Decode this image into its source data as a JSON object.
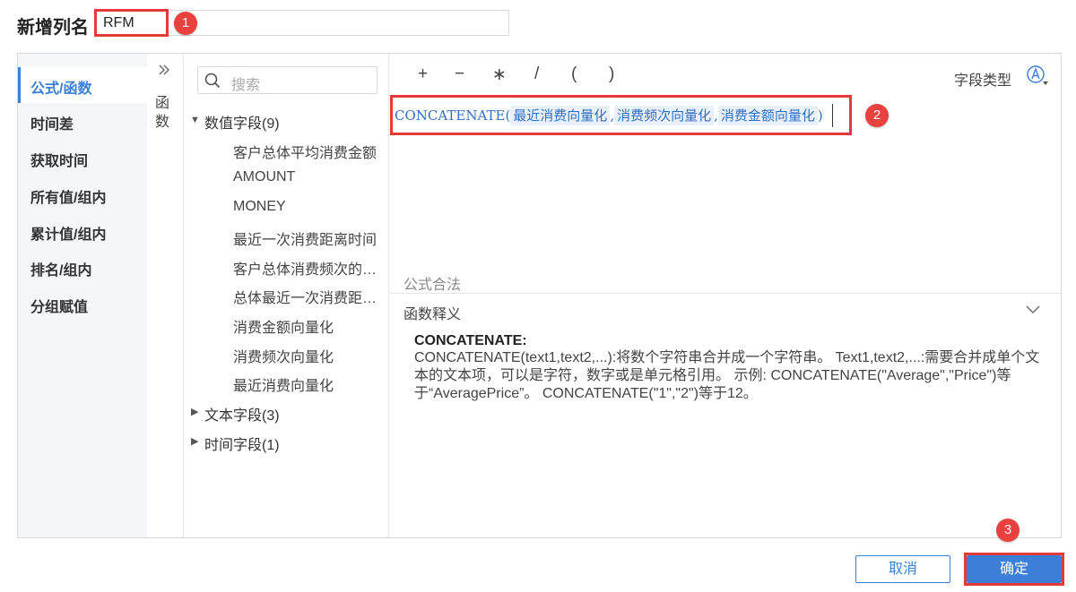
{
  "header": {
    "column_name_label": "新增列名",
    "column_name_value": "RFM"
  },
  "markers": [
    "1",
    "2",
    "3"
  ],
  "sidebar": {
    "collapse_icon": "double-chevron-right",
    "function_tab_label": "函数",
    "items": [
      {
        "label": "公式/函数",
        "active": true
      },
      {
        "label": "时间差"
      },
      {
        "label": "获取时间"
      },
      {
        "label": "所有值/组内"
      },
      {
        "label": "累计值/组内"
      },
      {
        "label": "排名/组内"
      },
      {
        "label": "分组赋值"
      }
    ]
  },
  "field_tree": {
    "search_placeholder": "搜索",
    "groups": [
      {
        "label": "数值字段(9)",
        "expanded": true,
        "items": [
          "客户总体平均消费金额",
          "AMOUNT",
          "MONEY",
          "最近一次消费距离时间",
          "客户总体消费频次的…",
          "总体最近一次消费距…",
          "消费金额向量化",
          "消费频次向量化",
          "最近消费向量化"
        ]
      },
      {
        "label": "文本字段(3)",
        "expanded": false
      },
      {
        "label": "时间字段(1)",
        "expanded": false
      }
    ]
  },
  "editor": {
    "operators": [
      "+",
      "−",
      "∗",
      "/",
      "(",
      ")"
    ],
    "field_type_label": "字段类型",
    "formula": {
      "function": "CONCATENATE",
      "open": "(",
      "args": [
        "最近消费向量化",
        "消费频次向量化",
        "消费金额向量化"
      ],
      "separator": ",",
      "close": ")"
    },
    "validation": "公式合法",
    "definition_title": "函数释义",
    "definition_name": "CONCATENATE:",
    "definition_body": "CONCATENATE(text1,text2,...):将数个字符串合并成一个字符串。 Text1,text2,...:需要合并成单个文本的文本项，可以是字符，数字或是单元格引用。 示例: CONCATENATE(\"Average\",\"Price\")等于“AveragePrice”。 CONCATENATE(\"1\",\"2\")等于12。"
  },
  "footer": {
    "cancel_label": "取消",
    "ok_label": "确定"
  },
  "colors": {
    "accent": "#3b7fd8",
    "highlight": "#e43a3a"
  }
}
